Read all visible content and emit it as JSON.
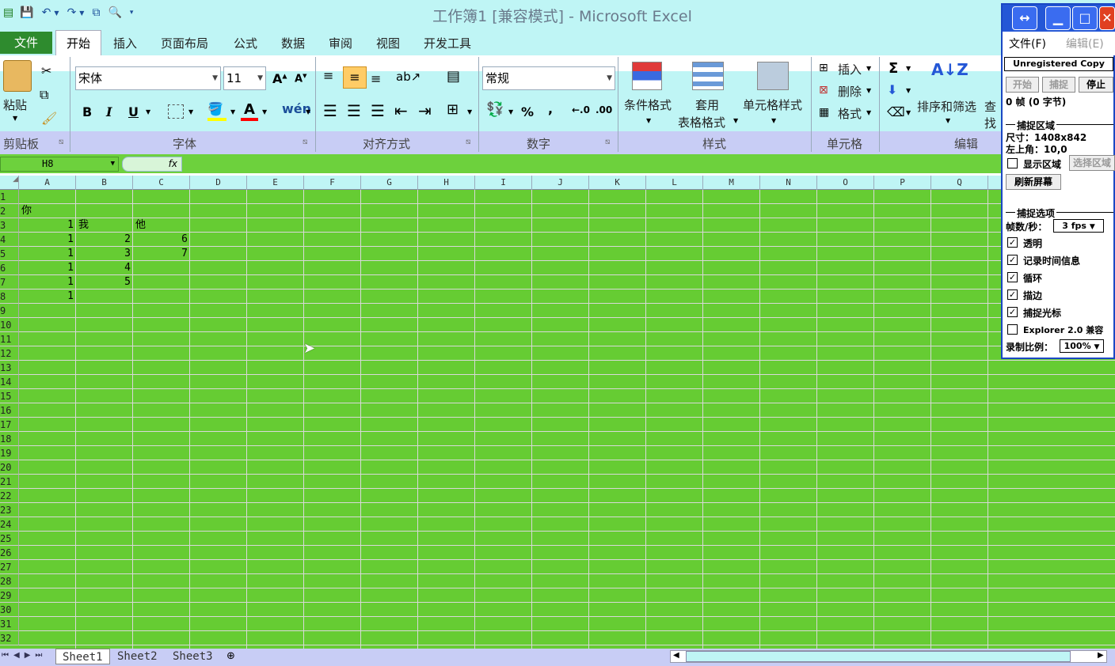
{
  "window": {
    "title": "工作簿1  [兼容模式] - Microsoft Excel"
  },
  "tabs": {
    "file": "文件",
    "home": "开始",
    "insert": "插入",
    "page_layout": "页面布局",
    "formulas": "公式",
    "data": "数据",
    "review": "审阅",
    "view": "视图",
    "developer": "开发工具"
  },
  "ribbon": {
    "clipboard": {
      "label": "剪贴板",
      "paste": "粘贴"
    },
    "font": {
      "label": "字体",
      "font_name": "宋体",
      "font_size": "11",
      "bold": "B",
      "italic": "I",
      "underline": "U"
    },
    "alignment": {
      "label": "对齐方式"
    },
    "number": {
      "label": "数字",
      "format": "常规",
      "percent": "%",
      "comma": ","
    },
    "styles": {
      "label": "样式",
      "conditional": "条件格式",
      "table_format_1": "套用",
      "table_format_2": "表格格式",
      "cell_styles": "单元格样式"
    },
    "cells": {
      "label": "单元格",
      "insert": "插入",
      "delete": "删除",
      "format": "格式"
    },
    "editing": {
      "label": "编辑",
      "sort_filter": "排序和筛选",
      "find": "查找"
    }
  },
  "formula_bar": {
    "name_box": "H8",
    "fx": "fx"
  },
  "columns": [
    "A",
    "B",
    "C",
    "D",
    "E",
    "F",
    "G",
    "H",
    "I",
    "J",
    "K",
    "L",
    "M",
    "N",
    "O",
    "P",
    "Q"
  ],
  "rows": [
    "1",
    "2",
    "3",
    "4",
    "5",
    "6",
    "7",
    "8",
    "9",
    "10",
    "11",
    "12",
    "13",
    "14",
    "15",
    "16",
    "17",
    "18",
    "19",
    "20",
    "21",
    "22",
    "23",
    "24",
    "25",
    "26",
    "27",
    "28",
    "29",
    "30",
    "31",
    "32"
  ],
  "cells": {
    "A2": "你",
    "A3": "1",
    "B3": "我",
    "C3": "他",
    "A4": "1",
    "B4": "2",
    "C4": "6",
    "A5": "1",
    "B5": "3",
    "C5": "7",
    "A6": "1",
    "B6": "4",
    "A7": "1",
    "B7": "5",
    "A8": "1"
  },
  "sheets": [
    "Sheet1",
    "Sheet2",
    "Sheet3"
  ],
  "capture_tool": {
    "menu_file": "文件(F)",
    "menu_edit": "编辑(E)",
    "unregistered": "Unregistered Copy",
    "btn_start": "开始",
    "btn_capture": "捕捉",
    "btn_stop": "停止",
    "frames": "0 帧 (0 字节)",
    "section_area": "捕捉区域",
    "size": "尺寸：1408x842",
    "top_left": "左上角：10,0",
    "show_area": "显示区域",
    "select_area": "选择区域",
    "refresh": "刷新屏幕",
    "section_options": "捕捉选项",
    "fps_label": "帧数/秒：",
    "fps_value": "3 fps",
    "opt_transparent": "透明",
    "opt_timestamp": "记录时间信息",
    "opt_loop": "循环",
    "opt_outline": "描边",
    "opt_cursor": "捕捉光标",
    "opt_explorer": "Explorer 2.0 兼容",
    "scale_label": "录制比例：",
    "scale_value": "100%"
  },
  "colors": {
    "sheet_bg": "#66cc33",
    "chrome": "#bff5f5",
    "group_bar": "#c8cdf5",
    "capture_blue": "#2457d6"
  }
}
